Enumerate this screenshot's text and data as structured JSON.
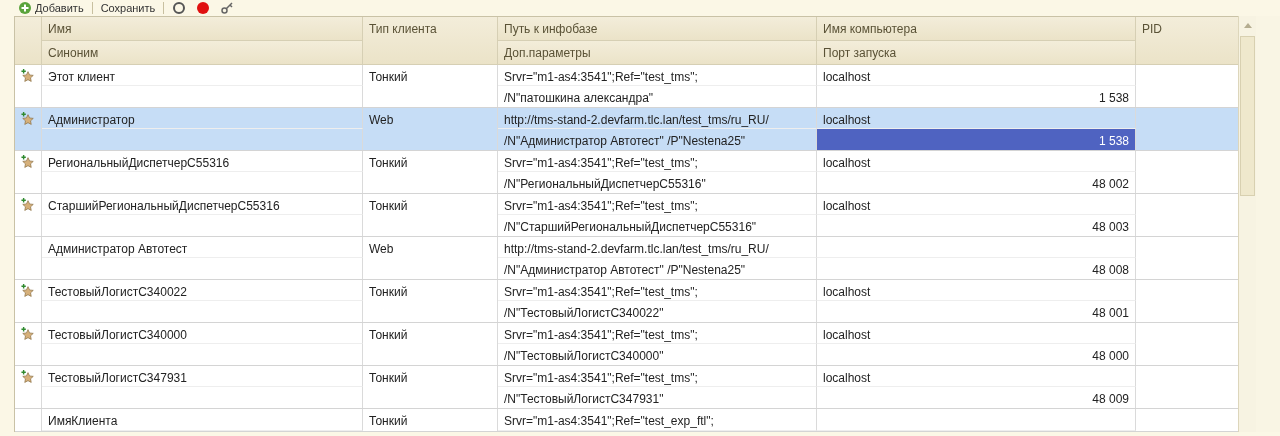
{
  "toolbar": {
    "buttons": [
      {
        "kind": "add",
        "label": "Добавить"
      },
      {
        "kind": "save",
        "label": "Сохранить"
      },
      {
        "kind": "refresh"
      },
      {
        "kind": "stop"
      },
      {
        "kind": "key"
      }
    ]
  },
  "table": {
    "columns": [
      {
        "top": "Имя",
        "bottom": "Синоним"
      },
      {
        "top": "Тип клиента"
      },
      {
        "top": "Путь к инфобазе",
        "bottom": "Доп.параметры"
      },
      {
        "top": "Имя компьютера",
        "bottom": "Порт запуска"
      },
      {
        "top": "PID"
      }
    ],
    "rows": [
      {
        "marked": true,
        "selected": false,
        "name": "Этот клиент",
        "client_type": "Тонкий",
        "path": "Srvr=\"m1-as4:3541\";Ref=\"test_tms\";",
        "params": "/N\"патошкина александра\"",
        "computer": "localhost",
        "port": "1 538"
      },
      {
        "marked": true,
        "selected": true,
        "name": "Администратор",
        "client_type": "Web",
        "path": "http://tms-stand-2.devfarm.tlc.lan/test_tms/ru_RU/",
        "params": "/N\"Администратор Автотест\" /P\"Nestena25\"",
        "computer": "localhost",
        "port": "1 538"
      },
      {
        "marked": true,
        "selected": false,
        "name": "РегиональныйДиспетчерС55316",
        "client_type": "Тонкий",
        "path": "Srvr=\"m1-as4:3541\";Ref=\"test_tms\";",
        "params": "/N\"РегиональныйДиспетчерС55316\"",
        "computer": "localhost",
        "port": "48 002"
      },
      {
        "marked": true,
        "selected": false,
        "name": "СтаршийРегиональныйДиспетчерС55316",
        "client_type": "Тонкий",
        "path": "Srvr=\"m1-as4:3541\";Ref=\"test_tms\";",
        "params": "/N\"СтаршийРегиональныйДиспетчерС55316\"",
        "computer": "localhost",
        "port": "48 003"
      },
      {
        "marked": false,
        "selected": false,
        "name": "Администратор Автотест",
        "client_type": "Web",
        "path": "http://tms-stand-2.devfarm.tlc.lan/test_tms/ru_RU/",
        "params": "/N\"Администратор Автотест\" /P\"Nestena25\"",
        "port": "48 008"
      },
      {
        "marked": true,
        "selected": false,
        "name": "ТестовыйЛогистС340022",
        "client_type": "Тонкий",
        "path": "Srvr=\"m1-as4:3541\";Ref=\"test_tms\";",
        "params": "/N\"ТестовыйЛогистС340022\"",
        "computer": "localhost",
        "port": "48 001"
      },
      {
        "marked": true,
        "selected": false,
        "name": "ТестовыйЛогистС340000",
        "client_type": "Тонкий",
        "path": "Srvr=\"m1-as4:3541\";Ref=\"test_tms\";",
        "params": "/N\"ТестовыйЛогистС340000\"",
        "computer": "localhost",
        "port": "48 000"
      },
      {
        "marked": true,
        "selected": false,
        "name": "ТестовыйЛогистС347931",
        "client_type": "Тонкий",
        "path": "Srvr=\"m1-as4:3541\";Ref=\"test_tms\";",
        "params": "/N\"ТестовыйЛогистС347931\"",
        "computer": "localhost",
        "port": "48 009"
      },
      {
        "marked": false,
        "selected": false,
        "partial": true,
        "name": "ИмяКлиента",
        "client_type": "Тонкий",
        "path": "Srvr=\"m1-as4:3541\";Ref=\"test_exp_ftl\";"
      }
    ]
  }
}
